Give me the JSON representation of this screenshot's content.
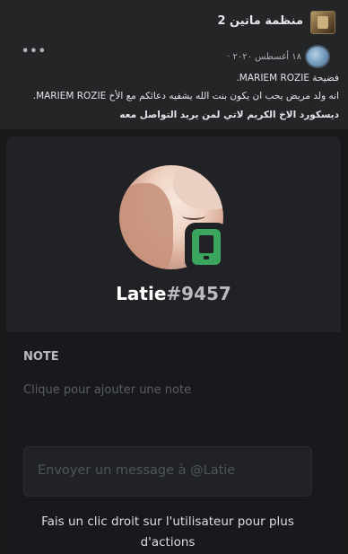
{
  "group": {
    "name": "منظمة ماتين 2",
    "thumb_icon": "group-cover-image"
  },
  "post": {
    "date": "١٨ أغسطس ٢٠٢٠ ·",
    "more_label": "•••",
    "lines": [
      "فضيحة MARIEM ROZIE.",
      "انه ولد مريض يحب ان يكون بنت الله يشفيه دعائكم مع الأخ MARIEM ROZIE.",
      "ديسكورد الاخ الكريم لاتي لمن يريد التواصل معه"
    ]
  },
  "profile": {
    "name": "Latie",
    "discriminator": "#9457",
    "status_icon": "mobile-online-icon",
    "status_color": "#3ba55d"
  },
  "note": {
    "heading": "NOTE",
    "placeholder": "Clique pour ajouter une note"
  },
  "message": {
    "placeholder": "Envoyer un message à @Latie"
  },
  "hint": "Fais un clic droit sur l'utilisateur pour plus d'actions"
}
